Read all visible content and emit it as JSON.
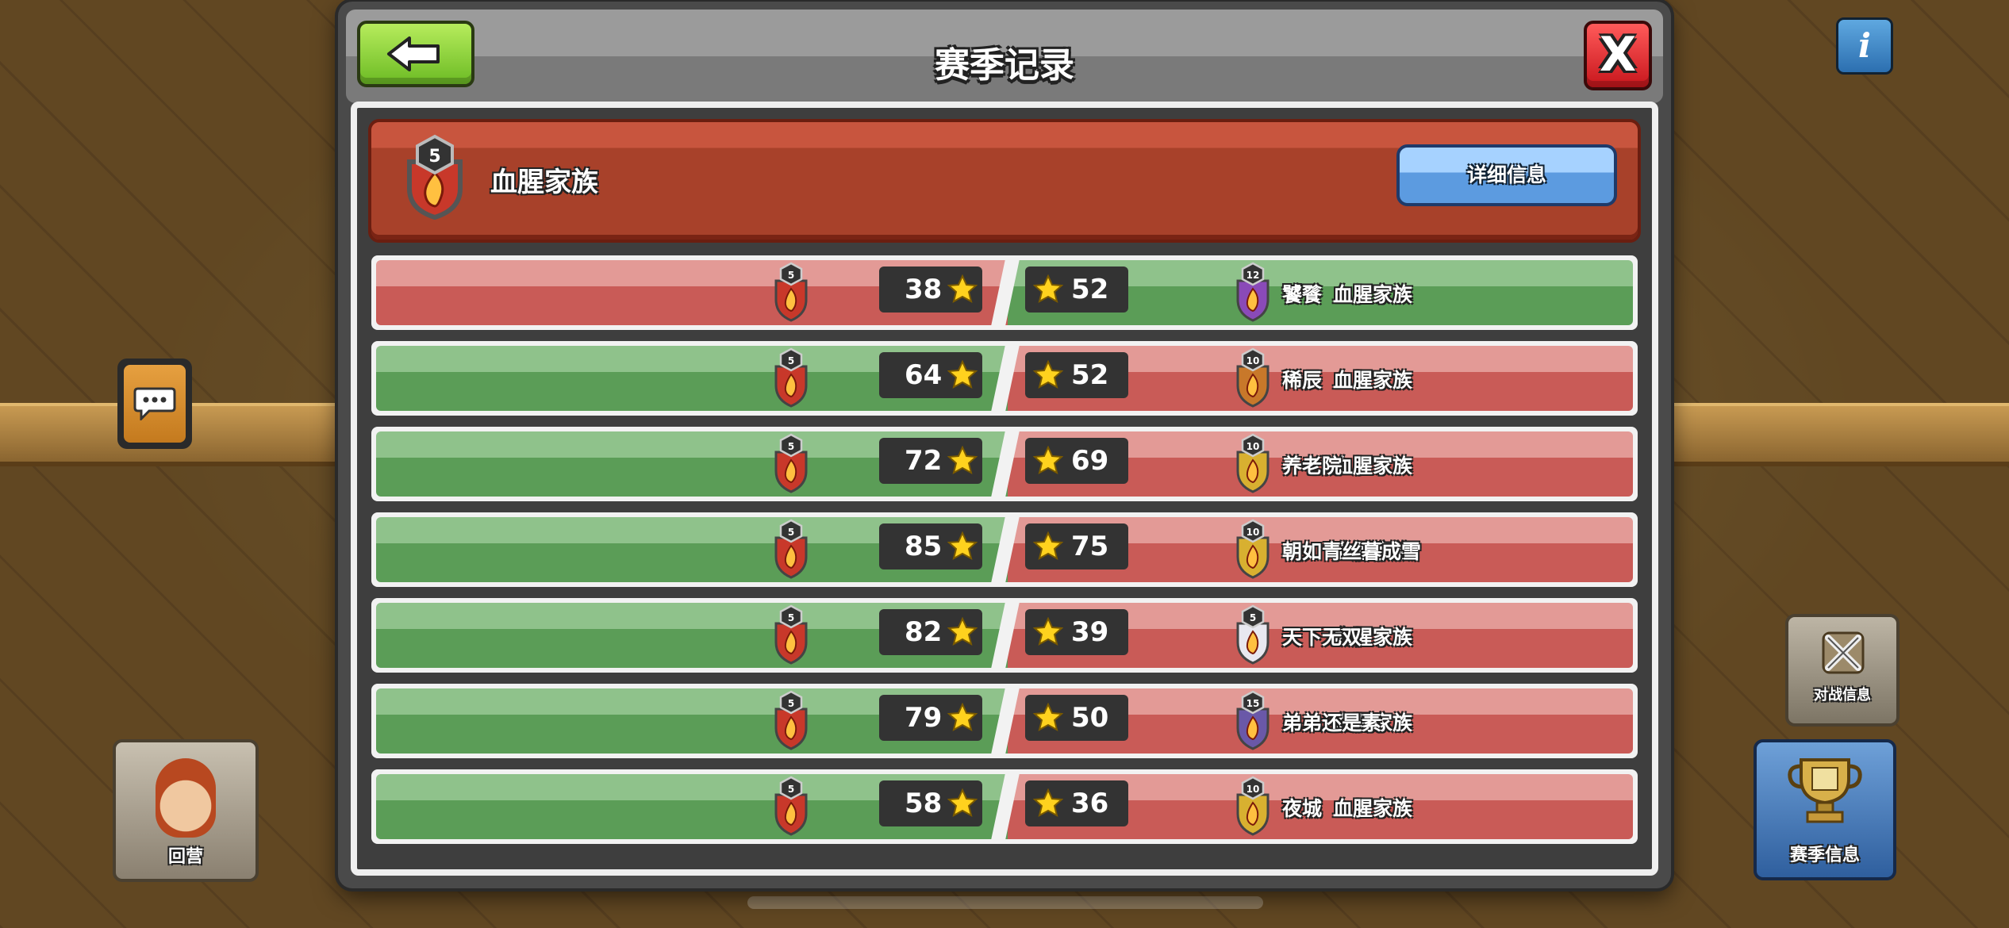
{
  "window": {
    "title": "赛季记录"
  },
  "clan": {
    "name": "血腥家族",
    "level": "5",
    "detail_label": "详细信息"
  },
  "rows": [
    {
      "own_name": "血腥家族",
      "own_level": "5",
      "own_stars": "38",
      "opp_stars": "52",
      "opp_name": "饕餮",
      "opp_level": "12",
      "result": "loss"
    },
    {
      "own_name": "血腥家族",
      "own_level": "5",
      "own_stars": "64",
      "opp_stars": "52",
      "opp_name": "稀辰",
      "opp_level": "10",
      "result": "win"
    },
    {
      "own_name": "血腥家族",
      "own_level": "5",
      "own_stars": "72",
      "opp_stars": "69",
      "opp_name": "养老院",
      "opp_level": "10",
      "result": "win"
    },
    {
      "own_name": "血腥家族",
      "own_level": "5",
      "own_stars": "85",
      "opp_stars": "75",
      "opp_name": "朝如青丝暮成雪",
      "opp_level": "10",
      "result": "win"
    },
    {
      "own_name": "血腥家族",
      "own_level": "5",
      "own_stars": "82",
      "opp_stars": "39",
      "opp_name": "天下无双",
      "opp_level": "5",
      "result": "win"
    },
    {
      "own_name": "血腥家族",
      "own_level": "5",
      "own_stars": "79",
      "opp_stars": "50",
      "opp_name": "弟弟还是素",
      "opp_level": "15",
      "result": "win"
    },
    {
      "own_name": "血腥家族",
      "own_level": "5",
      "own_stars": "58",
      "opp_stars": "36",
      "opp_name": "夜城",
      "opp_level": "10",
      "result": "win"
    }
  ],
  "side": {
    "home_label": "回营",
    "battle_label": "对战信息",
    "season_label": "赛季信息",
    "info_glyph": "i"
  },
  "colors": {
    "win": "#5b9d57",
    "loss": "#c95b57",
    "accent": "#a8412a"
  },
  "icons": [
    "back-arrow-icon",
    "close-icon",
    "info-icon",
    "chat-icon",
    "star-icon",
    "clan-badge-icon",
    "trophy-icon",
    "swords-icon"
  ]
}
